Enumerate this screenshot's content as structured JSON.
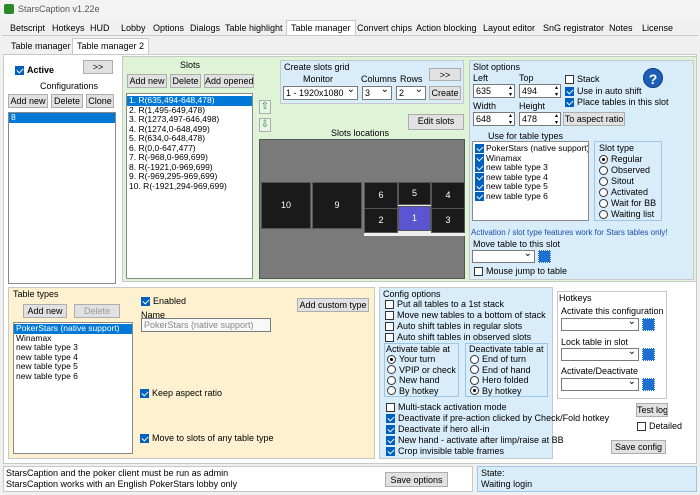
{
  "window": {
    "title": "StarsCaption v1.22e"
  },
  "tabs": [
    "Betscript",
    "Hotkeys",
    "HUD",
    "Lobby",
    "Options",
    "Dialogs",
    "Table highlight",
    "Table manager",
    "Convert chips",
    "Action blocking",
    "Layout editor",
    "SnG registrator",
    "Notes",
    "License"
  ],
  "subtabs": [
    "Table manager",
    "Table manager 2"
  ],
  "left": {
    "active_label": "Active",
    "arrow_label": ">>",
    "configs_label": "Configurations",
    "add_new": "Add new",
    "delete": "Delete",
    "clone": "Clone",
    "configs": [
      "8"
    ]
  },
  "slots": {
    "label": "Slots",
    "add_new": "Add new",
    "delete": "Delete",
    "add_opened": "Add opened",
    "items": [
      "1. R(635,494-648,478)",
      "2. R(1,495-649,478)",
      "3. R(1273,497-646,498)",
      "4. R(1274,0-648,499)",
      "5. R(634,0-648,478)",
      "6. R(0,0-647,477)",
      "7. R(-968,0-969,699)",
      "8. R(-1921,0-969,699)",
      "9. R(-969,295-969,699)",
      "10. R(-1921,294-969,699)"
    ]
  },
  "grid": {
    "title": "Create slots grid",
    "monitor_label": "Monitor",
    "columns_label": "Columns",
    "rows_label": "Rows",
    "monitor_value": "1 - 1920x1080",
    "columns_value": "3",
    "rows_value": "2",
    "arrow": ">>",
    "create": "Create",
    "edit_slots": "Edit slots",
    "locations_label": "Slots locations",
    "cells": [
      "6",
      "5",
      "4",
      "10",
      "9",
      "2",
      "1",
      "3"
    ]
  },
  "options": {
    "title": "Slot options",
    "left_label": "Left",
    "top_label": "Top",
    "width_label": "Width",
    "height_label": "Height",
    "left": "635",
    "top": "494",
    "width": "648",
    "height": "478",
    "stack": "Stack",
    "use_auto_shift": "Use in auto shift",
    "place_tables": "Place tables in this slot",
    "to_aspect": "To aspect ratio",
    "use_for_types": "Use for table types",
    "types": [
      "PokerStars (native support)",
      "Winamax",
      "new table type 3",
      "new table type 4",
      "new table type 5",
      "new table type 6"
    ],
    "slot_type_label": "Slot type",
    "slot_types": [
      "Regular",
      "Observed",
      "Sitout",
      "Activated",
      "Wait for BB",
      "Waiting list"
    ],
    "note": "Activation / slot type features work for Stars tables only!",
    "move_label": "Move table to this slot",
    "mouse_jump": "Mouse jump to table"
  },
  "tabletypes": {
    "title": "Table types",
    "add_new": "Add new",
    "delete": "Delete",
    "items": [
      "PokerStars (native support)",
      "Winamax",
      "new table type 3",
      "new table type 4",
      "new table type 5",
      "new table type 6"
    ],
    "enabled": "Enabled",
    "name_label": "Name",
    "name_value": "PokerStars (native support)",
    "add_custom": "Add custom type",
    "keep_aspect": "Keep aspect ratio",
    "move_to_any": "Move to slots of any table type"
  },
  "config": {
    "title": "Config options",
    "put_all": "Put all tables to a 1st stack",
    "move_new": "Move new tables to a bottom of stack",
    "auto_regular": "Auto shift tables in regular slots",
    "auto_observed": "Auto shift tables in observed slots",
    "activate_label": "Activate table at",
    "activate": [
      "Your turn",
      "VPIP or check",
      "New hand",
      "By hotkey"
    ],
    "deactivate_label": "Deactivate table at",
    "deactivate": [
      "End of turn",
      "End of hand",
      "Hero folded",
      "By hotkey"
    ],
    "multi_stack": "Multi-stack activation mode",
    "deact_pre": "Deactivate if pre-action clicked by Check/Fold hotkey",
    "deact_allin": "Deactivate if hero all-in",
    "new_hand": "New hand - activate after limp/raise at BB",
    "crop": "Crop invisible table frames",
    "test_log": "Test log",
    "detailed": "Detailed",
    "save_config": "Save config"
  },
  "hotkeys": {
    "title": "Hotkeys",
    "activate_config": "Activate this configuration",
    "lock_table": "Lock table in slot",
    "activate_deactivate": "Activate/Deactivate"
  },
  "status": {
    "line1": "StarsCaption and the poker client must be run as admin",
    "line2": "StarsCaption works with an English PokerStars lobby only",
    "save_options": "Save options",
    "state_label": "State:",
    "state_value": "Waiting login"
  }
}
